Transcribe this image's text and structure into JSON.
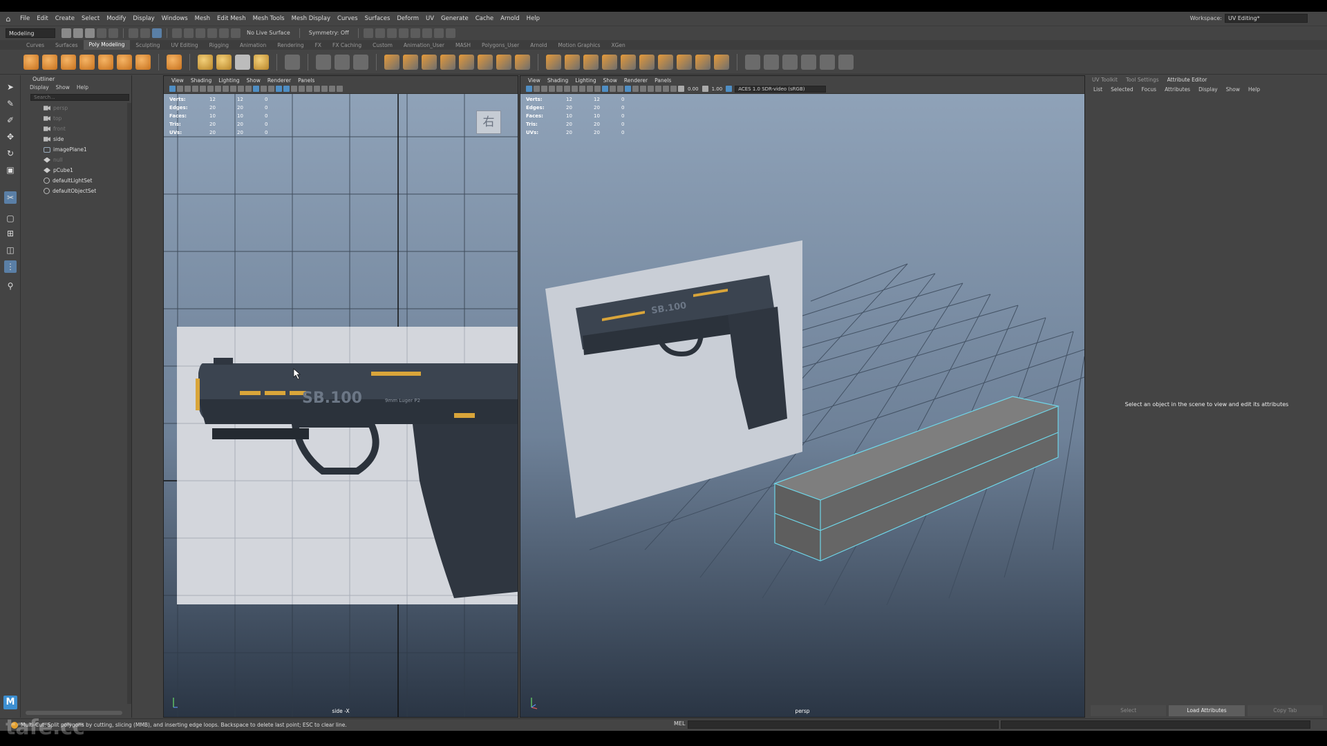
{
  "menubar": {
    "items": [
      "File",
      "Edit",
      "Create",
      "Select",
      "Modify",
      "Display",
      "Windows",
      "Mesh",
      "Edit Mesh",
      "Mesh Tools",
      "Mesh Display",
      "Curves",
      "Surfaces",
      "Deform",
      "UV",
      "Generate",
      "Cache",
      "Arnold",
      "Help"
    ],
    "workspace_label": "Workspace:",
    "workspace_value": "UV Editing*"
  },
  "statusline": {
    "mode": "Modeling",
    "live_surface": "No Live Surface",
    "symmetry": "Symmetry: Off"
  },
  "shelf": {
    "tabs": [
      "Curves",
      "Surfaces",
      "Poly Modeling",
      "Sculpting",
      "UV Editing",
      "Rigging",
      "Animation",
      "Rendering",
      "FX",
      "FX Caching",
      "Custom",
      "Animation_User",
      "MASH",
      "Polygons_User",
      "Arnold",
      "Motion Graphics",
      "XGen"
    ],
    "active_tab": "Poly Modeling"
  },
  "outliner": {
    "title": "Outliner",
    "menu": [
      "Display",
      "Show",
      "Help"
    ],
    "search_placeholder": "Search...",
    "items": [
      {
        "label": "persp",
        "icon": "camera-icon",
        "dim": true
      },
      {
        "label": "top",
        "icon": "camera-icon",
        "dim": true
      },
      {
        "label": "front",
        "icon": "camera-icon",
        "dim": true
      },
      {
        "label": "side",
        "icon": "camera-icon",
        "dim": false
      },
      {
        "label": "imagePlane1",
        "icon": "image-plane-icon",
        "dim": false
      },
      {
        "label": "null",
        "icon": "mesh-icon",
        "dim": true
      },
      {
        "label": "pCube1",
        "icon": "mesh-icon",
        "dim": false
      },
      {
        "label": "defaultLightSet",
        "icon": "set-icon",
        "dim": false
      },
      {
        "label": "defaultObjectSet",
        "icon": "set-icon",
        "dim": false
      }
    ]
  },
  "viewport_menu": [
    "View",
    "Shading",
    "Lighting",
    "Show",
    "Renderer",
    "Panels"
  ],
  "hud": {
    "rows": [
      {
        "label": "Verts:",
        "a": "12",
        "b": "12",
        "c": "0"
      },
      {
        "label": "Edges:",
        "a": "20",
        "b": "20",
        "c": "0"
      },
      {
        "label": "Faces:",
        "a": "10",
        "b": "10",
        "c": "0"
      },
      {
        "label": "Tris:",
        "a": "20",
        "b": "20",
        "c": "0"
      },
      {
        "label": "UVs:",
        "a": "20",
        "b": "20",
        "c": "0"
      }
    ]
  },
  "viewport_left": {
    "camera": "side -X",
    "corner_glyph": "右"
  },
  "viewport_right": {
    "camera": "persp",
    "exposure": "0.00",
    "gamma": "1.00",
    "color_space": "ACES 1.0 SDR-video (sRGB)"
  },
  "gun_text": {
    "model": "SB.100",
    "small": "9mm Luger P2"
  },
  "attribute_editor": {
    "tabs": [
      "UV Toolkit",
      "Tool Settings",
      "Attribute Editor"
    ],
    "active_tab": "Attribute Editor",
    "menu": [
      "List",
      "Selected",
      "Focus",
      "Attributes",
      "Display",
      "Show",
      "Help"
    ],
    "hint": "Select an object in the scene to view and edit its attributes",
    "buttons": [
      "Select",
      "Load Attributes",
      "Copy Tab"
    ]
  },
  "helpline": {
    "text": "Multi-Cut: Split polygons by cutting, slicing (MMB), and inserting edge loops. Backspace to delete last point; ESC to clear line.",
    "mel_label": "MEL"
  },
  "watermark": "tafe.cc",
  "colors": {
    "accent": "#5a7fa6",
    "maya_blue": "#3d8fd1",
    "cube_edge": "#6fd6e8",
    "gold": "#d9a53a"
  }
}
